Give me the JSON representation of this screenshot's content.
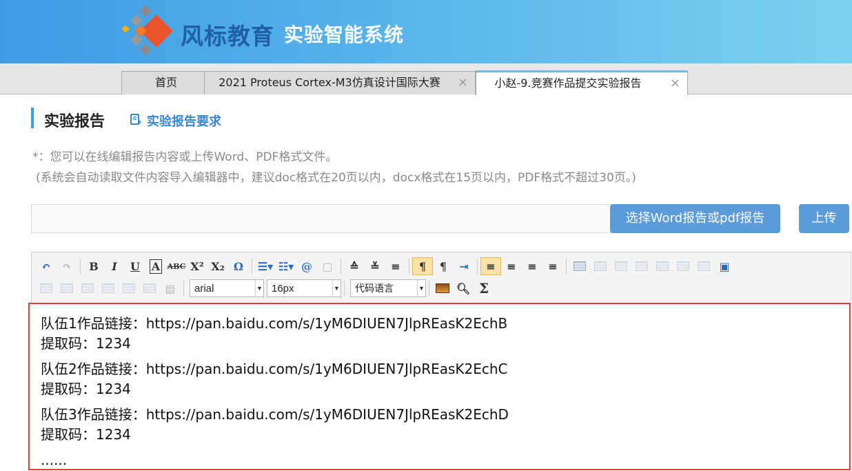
{
  "header": {
    "brand": "风标教育",
    "system": "实验智能系统",
    "logo_icon": "fengbiao-logo-icon"
  },
  "tabs": [
    {
      "label": "首页",
      "closable": false,
      "active": false
    },
    {
      "label": "2021 Proteus Cortex-M3仿真设计国际大赛",
      "closable": true,
      "active": false
    },
    {
      "label": "小赵-9.竞赛作品提交实验报告",
      "closable": true,
      "active": true
    }
  ],
  "close_glyph": "×",
  "section": {
    "title": "实验报告",
    "requirement_link": "实验报告要求"
  },
  "notes": {
    "line1": "*：您可以在线编辑报告内容或上传Word、PDF格式文件。",
    "line2": "(系统会自动读取文件内容导入编辑器中，建议doc格式在20页以内，docx格式在15页以内，PDF格式不超过30页。)"
  },
  "upload": {
    "select_label": "选择Word报告或pdf报告",
    "upload_label": "上传"
  },
  "toolbar": {
    "font_family": "arial",
    "font_size": "16px",
    "code_language": "代码语言",
    "colors": {
      "active_bg": "#fbe3a8",
      "button_bg": "#5b9bd9",
      "highlight_border": "#e53b3b"
    }
  },
  "editor": {
    "entries": [
      {
        "link": "队伍1作品链接：https://pan.baidu.com/s/1yM6DIUEN7JlpREasK2EchB",
        "code": "提取码：1234"
      },
      {
        "link": "队伍2作品链接：https://pan.baidu.com/s/1yM6DIUEN7JlpREasK2EchC",
        "code": "提取码：1234"
      },
      {
        "link": "队伍3作品链接：https://pan.baidu.com/s/1yM6DIUEN7JlpREasK2EchD",
        "code": "提取码：1234"
      }
    ],
    "ellipsis": "......"
  }
}
